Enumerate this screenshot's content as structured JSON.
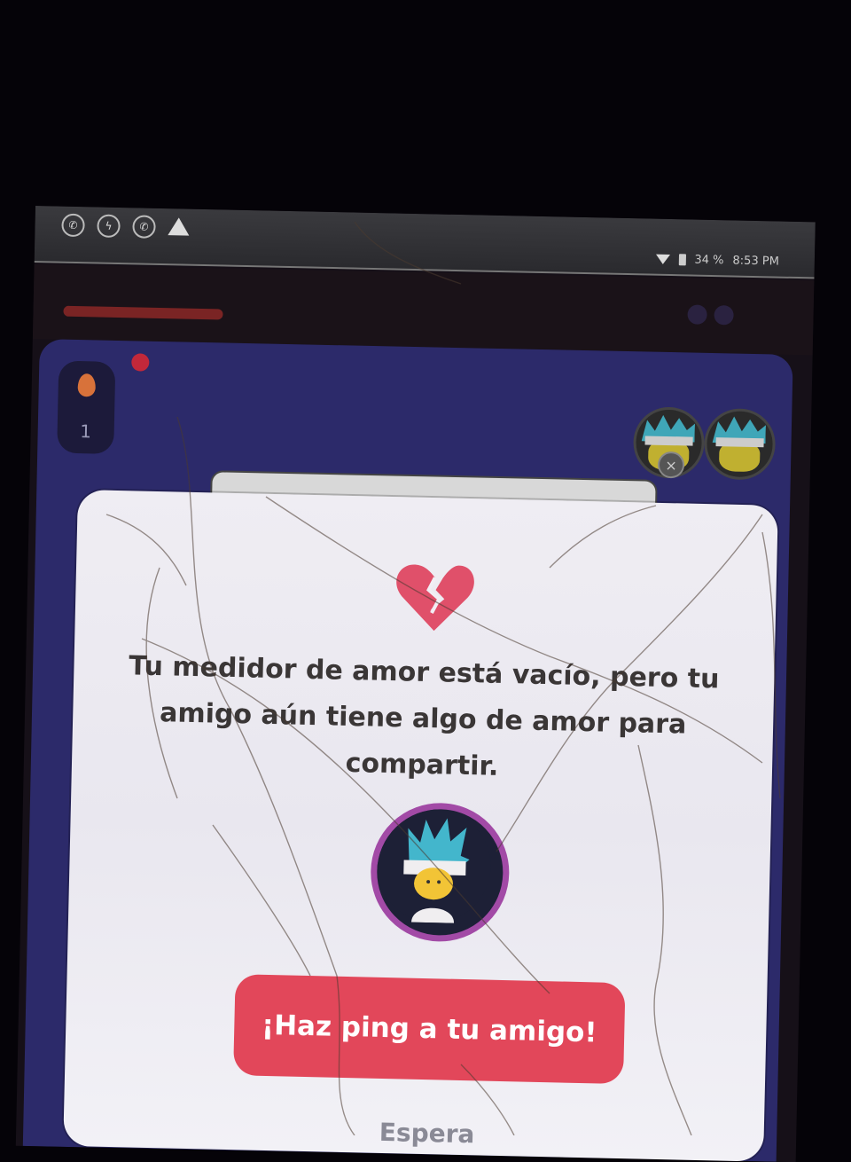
{
  "status_bar": {
    "left_icons": [
      "whatsapp-icon",
      "messenger-icon",
      "whatsapp-icon",
      "warning-icon"
    ],
    "battery": "34 %",
    "time": "8:53 PM"
  },
  "modal": {
    "icon": "broken-heart-icon",
    "message": "Tu medidor de amor está vacío, pero tu amigo aún tiene algo de amor para compartir.",
    "ping_button_label": "¡Haz ping a tu amigo!",
    "wait_label": "Espera"
  },
  "background": {
    "streak_count": "1"
  },
  "colors": {
    "ping_button": "#e2475a",
    "broken_heart": "#e0506a",
    "avatar_ring": "#a24aa6",
    "game_background": "#2c2a6a"
  }
}
